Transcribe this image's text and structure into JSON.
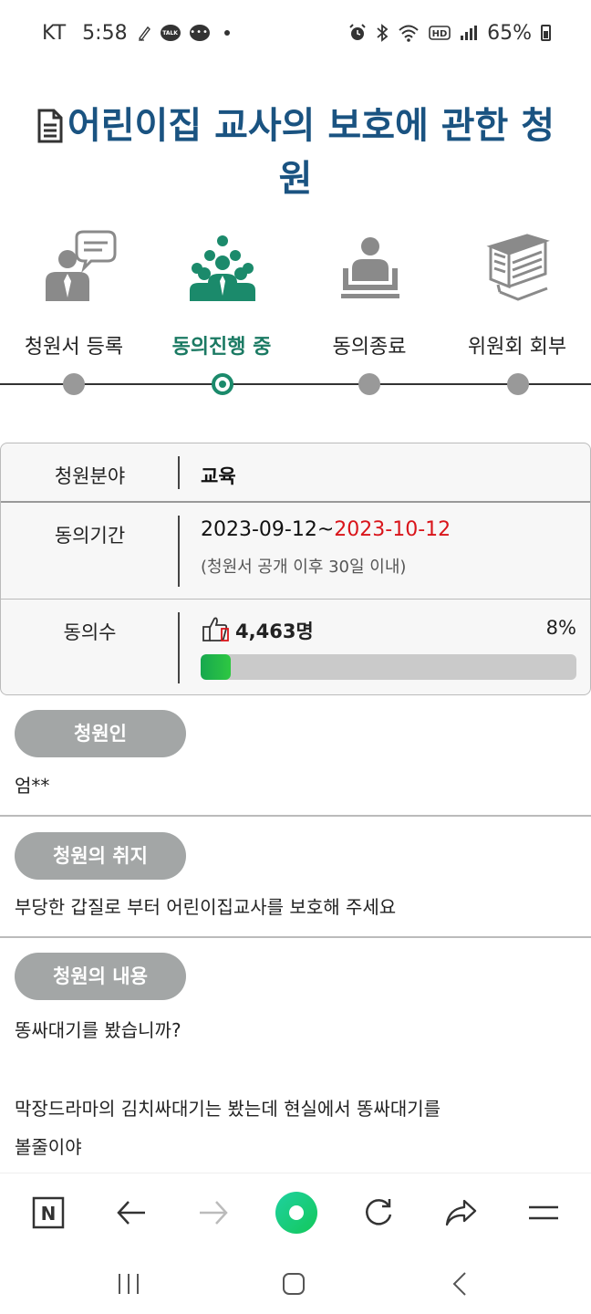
{
  "status_bar": {
    "carrier": "KT",
    "time": "5:58",
    "talk_label": "TALK",
    "battery_percent": "65%",
    "icons": [
      "pen-icon",
      "kakaotalk-icon",
      "chat-icon",
      "dot-icon",
      "alarm-icon",
      "bluetooth-icon",
      "wifi-icon",
      "hd-icon",
      "signal-icon",
      "battery-icon"
    ]
  },
  "page": {
    "title": "어린이집 교사의 보호에 관한 청원",
    "title_icon": "document-icon"
  },
  "steps": [
    {
      "label": "청원서 등록",
      "icon": "petition-register-icon",
      "active": false
    },
    {
      "label": "동의진행 중",
      "icon": "agreement-progress-icon",
      "active": true
    },
    {
      "label": "동의종료",
      "icon": "agreement-end-icon",
      "active": false
    },
    {
      "label": "위원회 회부",
      "icon": "committee-referral-icon",
      "active": false
    }
  ],
  "info": {
    "field_label": "청원분야",
    "field_value": "교육",
    "period_label": "동의기간",
    "period_start": "2023-09-12~",
    "period_end": "2023-10-12",
    "period_note": "(청원서 공개 이후 30일 이내)",
    "count_label": "동의수",
    "count_value": "4,463명",
    "percent_label": "8%",
    "progress_fraction": 0.08
  },
  "sections": {
    "petitioner_label": "청원인",
    "petitioner_value": "엄**",
    "purpose_label": "청원의 취지",
    "purpose_value": "부당한 갑질로 부터 어린이집교사를 보호해 주세요",
    "content_label": "청원의 내용",
    "content_line1": "똥싸대기를 봤습니까?",
    "content_line2": "막장드라마의 김치싸대기는 봤는데 현실에서 똥싸대기를",
    "content_line3": "볼줄이야"
  },
  "browser_nav": {
    "icons": [
      "naver-icon",
      "back-icon",
      "forward-icon",
      "home-green-icon",
      "refresh-icon",
      "share-icon",
      "menu-icon"
    ],
    "naver_letter": "N"
  },
  "system_nav": {
    "icons": [
      "recent-apps-icon",
      "home-icon",
      "back-nav-icon"
    ]
  },
  "colors": {
    "title": "#1a5381",
    "active_step": "#1b7a63",
    "end_date": "#d9141a",
    "progress": "#17a84e",
    "pill": "#a3a6a6"
  }
}
